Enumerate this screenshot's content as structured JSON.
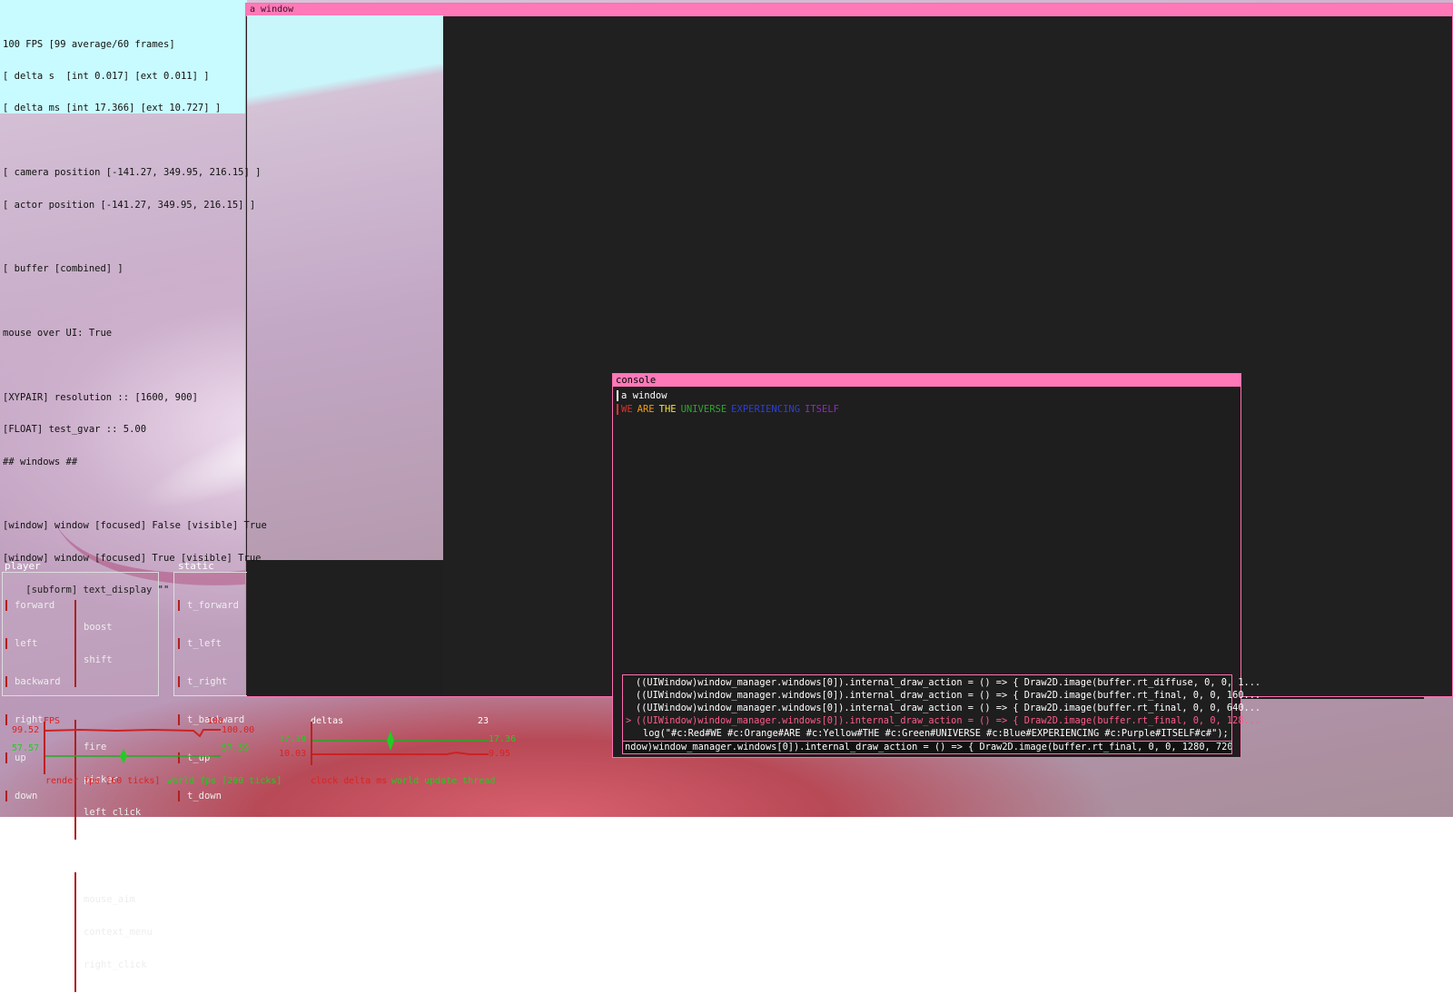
{
  "hud": {
    "fps_line": "100 FPS [99 average/60 frames]",
    "delta_s": "[ delta s  [int 0.017] [ext 0.011] ]",
    "delta_ms": "[ delta ms [int 17.366] [ext 10.727] ]",
    "camera": "[ camera position [-141.27, 349.95, 216.15] ]",
    "actor": "[ actor position [-141.27, 349.95, 216.15] ]",
    "buffer": "[ buffer [combined] ]",
    "mouse": "mouse over UI: True",
    "resolution": "[XYPAIR] resolution :: [1600, 900]",
    "gvar": "[FLOAT] test_gvar :: 5.00",
    "windows": "## windows ##",
    "win1": "[window] window [focused] False [visible] True",
    "win2": "[window] window [focused] True [visible] True",
    "subform": "    [subform] text_display \"\""
  },
  "window_title": "a window",
  "player_panel": {
    "title": "player",
    "keys_left": [
      "forward",
      "left",
      "backward",
      "right",
      "up",
      "down"
    ],
    "keys_right_1": [
      "boost",
      "shift"
    ],
    "keys_right_2": [
      "fire",
      "picker",
      "left_click"
    ],
    "keys_right_3": [
      "mouse_aim",
      "context_menu",
      "right_click"
    ]
  },
  "static_panel": {
    "title": "static",
    "keys": [
      "t_forward",
      "t_left",
      "t_right",
      "t_backward",
      "t_up",
      "t_down"
    ]
  },
  "fps_graph": {
    "title": "FPS",
    "max_label": "100",
    "left_top": "99.52",
    "left_bottom": "57.57",
    "right_top": "100.00",
    "right_bottom": "57.59",
    "caption_red": "render fps [60 ticks]",
    "caption_green": "world fps [290 ticks]"
  },
  "deltas_graph": {
    "title": "deltas",
    "max_label": "23",
    "left_top": "17.39",
    "left_bottom": "10.03",
    "right_top": "17.36",
    "right_bottom": "9.95",
    "caption_red": "clock delta ms",
    "caption_green": "world update thread"
  },
  "console": {
    "title": "console",
    "sub": "a window",
    "message": [
      {
        "text": "WE",
        "color": "#e03030"
      },
      {
        "text": "ARE",
        "color": "#f39c12"
      },
      {
        "text": "THE",
        "color": "#f5e13c"
      },
      {
        "text": "UNIVERSE",
        "color": "#2fa52f"
      },
      {
        "text": "EXPERIENCING",
        "color": "#2c3fd4"
      },
      {
        "text": "ITSELF",
        "color": "#8e2cb8"
      }
    ],
    "log_lines": [
      "((UIWindow)window_manager.windows[0]).internal_draw_action = () => { Draw2D.image(buffer.rt_diffuse, 0, 0, 1...",
      "((UIWindow)window_manager.windows[0]).internal_draw_action = () => { Draw2D.image(buffer.rt_final, 0, 0, 160...",
      "((UIWindow)window_manager.windows[0]).internal_draw_action = () => { Draw2D.image(buffer.rt_final, 0, 0, 640...",
      "((UIWindow)window_manager.windows[0]).internal_draw_action = () => { Draw2D.image(buffer.rt_final, 0, 0, 128...",
      "log(\"#c:Red#WE #c:Orange#ARE #c:Yellow#THE #c:Green#UNIVERSE #c:Blue#EXPERIENCING #c:Purple#ITSELF#c#\");"
    ],
    "log_prompt": ">",
    "input_value": "ndow)window_manager.windows[0]).internal_draw_action = () => { Draw2D.image(buffer.rt_final, 0, 0, 1280, 720); };"
  },
  "colors": {
    "accent_pink": "#ff78b8",
    "hud_bg": "#c8fbff",
    "console_bg": "#1e1e1e"
  }
}
